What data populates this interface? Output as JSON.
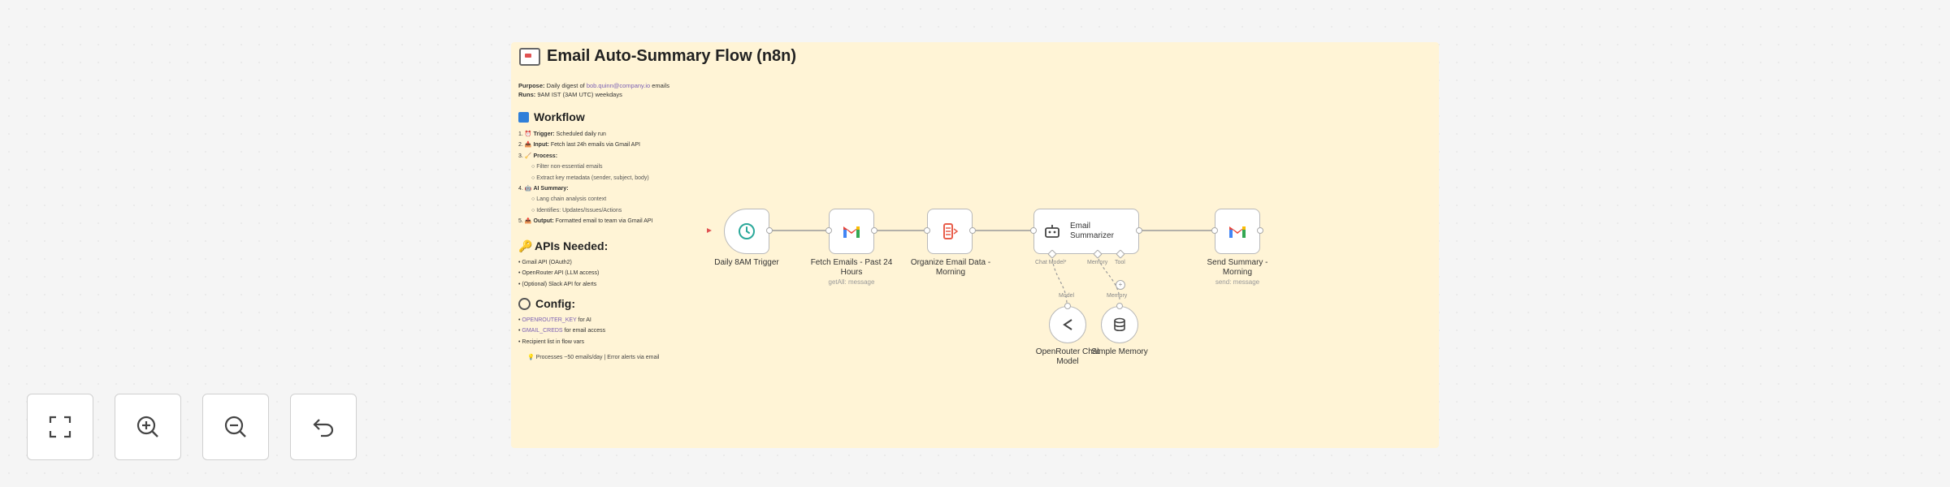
{
  "note": {
    "title": "Email Auto-Summary Flow (n8n)",
    "purpose_label": "Purpose:",
    "purpose_text": "Daily digest of",
    "purpose_link": "bob.quinn@company.io",
    "purpose_end": "emails",
    "runs_label": "Runs:",
    "runs_text": "9AM IST (3AM UTC) weekdays",
    "workflow_heading": "Workflow",
    "workflow_items": [
      {
        "num": "1. ⏰",
        "label": "Trigger:",
        "text": "Scheduled daily run"
      },
      {
        "num": "2. 📥",
        "label": "Input:",
        "text": "Fetch last 24h emails via Gmail API"
      },
      {
        "num": "3. 🧹",
        "label": "Process:",
        "text": ""
      }
    ],
    "process_subitems": [
      "Filter non-essential emails",
      "Extract key metadata (sender, subject, body)"
    ],
    "ai_item": {
      "num": "4. 🤖",
      "label": "AI Summary:",
      "text": ""
    },
    "ai_subitems": [
      "Lang chain analysis context",
      "Identifies: Updates/Issues/Actions"
    ],
    "output_item": {
      "num": "5. 📤",
      "label": "Output:",
      "text": "Formatted email to team via Gmail API"
    },
    "apis_heading": "APIs Needed:",
    "apis": [
      "Gmail API (OAuth2)",
      "OpenRouter API (LLM access)",
      "(Optional) Slack API for alerts"
    ],
    "config_heading": "Config:",
    "config": [
      {
        "code": "OPENROUTER_KEY",
        "text": "for AI"
      },
      {
        "code": "GMAIL_CREDS",
        "text": "for email access"
      },
      {
        "code": "",
        "text": "Recipient list in flow vars"
      }
    ],
    "tip": "💡 Processes ~50 emails/day | Error alerts via email"
  },
  "nodes": {
    "trigger": {
      "label": "Daily 8AM Trigger"
    },
    "fetch": {
      "label_line1": "Fetch Emails - Past 24",
      "label_line2": "Hours",
      "sub": "getAll: message"
    },
    "organize": {
      "label_line1": "Organize Email Data -",
      "label_line2": "Morning"
    },
    "summarizer": {
      "label_line1": "Email",
      "label_line2": "Summarizer",
      "port_chat": "Chat Model*",
      "port_memory": "Memory",
      "port_tool": "Tool"
    },
    "send": {
      "label_line1": "Send Summary -",
      "label_line2": "Morning",
      "sub": "send: message"
    },
    "openrouter": {
      "label_line1": "OpenRouter Chat",
      "label_line2": "Model",
      "conn_label": "Model"
    },
    "memory": {
      "label": "Simple Memory",
      "conn_label": "Memory"
    }
  },
  "controls": {
    "fit": "fit-view",
    "zoom_in": "zoom-in",
    "zoom_out": "zoom-out",
    "reset": "reset-zoom"
  },
  "colors": {
    "sticky_bg": "#fff4d6",
    "trigger_icon": "#2aa89a",
    "gmail_red": "#ea4335",
    "organize_icon": "#e85d4a"
  }
}
